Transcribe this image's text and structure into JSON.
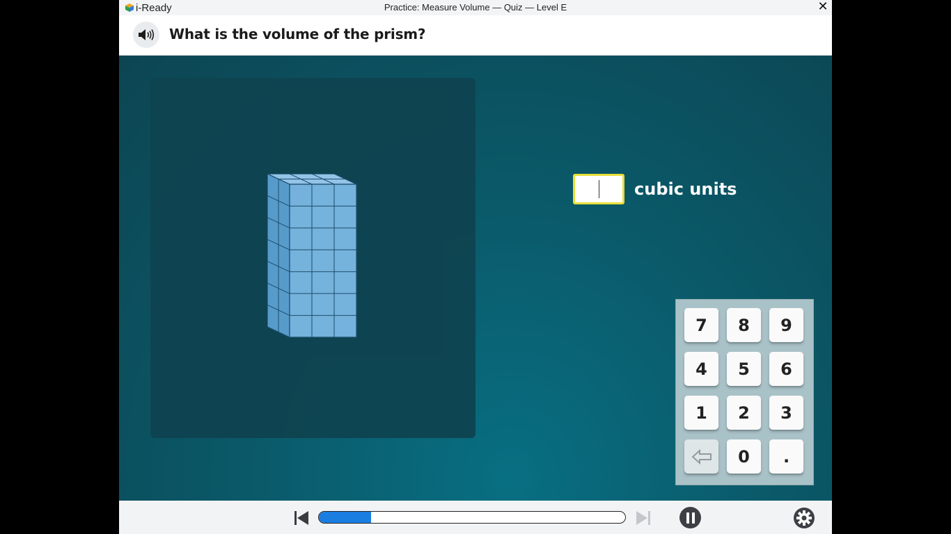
{
  "window": {
    "app_name": "i-Ready",
    "title": "Practice: Measure Volume — Quiz — Level E",
    "close_glyph": "✕"
  },
  "question": {
    "text": "What is the volume of the prism?",
    "audio_icon": "speaker-icon"
  },
  "figure": {
    "description_icon": "rectangular-prism",
    "front_columns": 3,
    "rows": 7,
    "depth": 2,
    "cube_color": "#7bb7e3",
    "side_color": "#5c9fd1",
    "top_color": "#9bcaef"
  },
  "answer": {
    "value": "",
    "unit": "cubic units",
    "border_color": "#e8df3a"
  },
  "keypad": {
    "keys": [
      "7",
      "8",
      "9",
      "4",
      "5",
      "6",
      "1",
      "2",
      "3",
      "⇦",
      "0",
      "."
    ]
  },
  "bottom": {
    "progress": 0.17,
    "progress_color": "#1a7de0"
  },
  "colors": {
    "stage_bg": "#0a5a6a",
    "panel_bg": "#0f4350",
    "keypad_bg": "#a9c2c8"
  }
}
